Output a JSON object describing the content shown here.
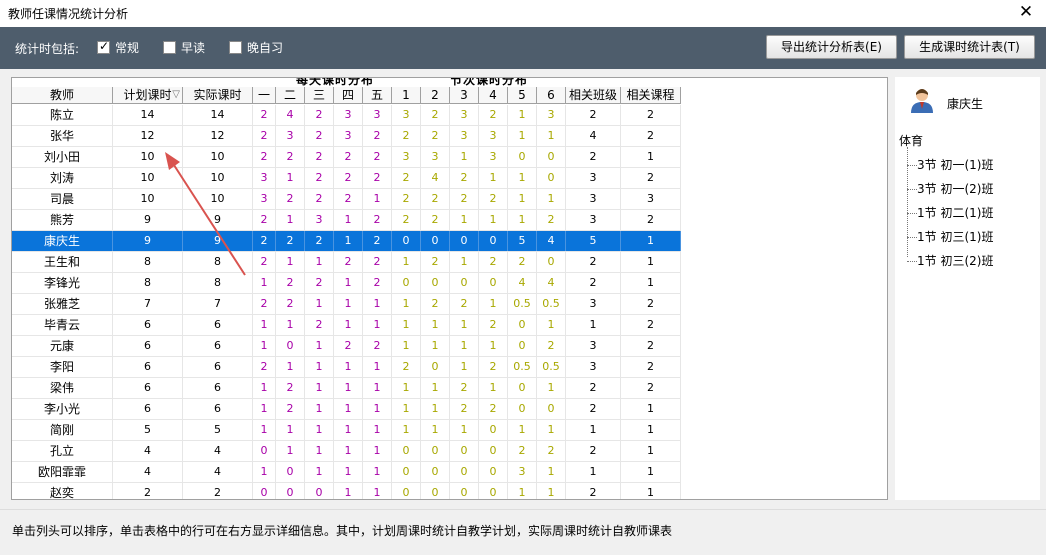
{
  "window": {
    "title": "教师任课情况统计分析",
    "close_glyph": "✕"
  },
  "options": {
    "label": "统计时包括:",
    "items": [
      {
        "label": "常规",
        "checked": true
      },
      {
        "label": "早读",
        "checked": false
      },
      {
        "label": "晚自习",
        "checked": false
      }
    ]
  },
  "buttons": {
    "export": "导出统计分析表(E)",
    "generate": "生成课时统计表(T)"
  },
  "table": {
    "group_daily": "每天课时分布",
    "group_period": "节次课时分布",
    "columns": [
      "教师",
      "计划课时",
      "实际课时",
      "一",
      "二",
      "三",
      "四",
      "五",
      "1",
      "2",
      "3",
      "4",
      "5",
      "6",
      "相关班级",
      "相关课程"
    ],
    "sort_glyph": "▽",
    "selected_row": 6,
    "rows": [
      [
        "陈立",
        "14",
        "14",
        "2",
        "4",
        "2",
        "3",
        "3",
        "3",
        "2",
        "3",
        "2",
        "1",
        "3",
        "2",
        "2"
      ],
      [
        "张华",
        "12",
        "12",
        "2",
        "3",
        "2",
        "3",
        "2",
        "2",
        "2",
        "3",
        "3",
        "1",
        "1",
        "4",
        "2"
      ],
      [
        "刘小田",
        "10",
        "10",
        "2",
        "2",
        "2",
        "2",
        "2",
        "3",
        "3",
        "1",
        "3",
        "0",
        "0",
        "2",
        "1"
      ],
      [
        "刘涛",
        "10",
        "10",
        "3",
        "1",
        "2",
        "2",
        "2",
        "2",
        "4",
        "2",
        "1",
        "1",
        "0",
        "3",
        "2"
      ],
      [
        "司晨",
        "10",
        "10",
        "3",
        "2",
        "2",
        "2",
        "1",
        "2",
        "2",
        "2",
        "2",
        "1",
        "1",
        "3",
        "3"
      ],
      [
        "熊芳",
        "9",
        "9",
        "2",
        "1",
        "3",
        "1",
        "2",
        "2",
        "2",
        "1",
        "1",
        "1",
        "2",
        "3",
        "2"
      ],
      [
        "康庆生",
        "9",
        "9",
        "2",
        "2",
        "2",
        "1",
        "2",
        "0",
        "0",
        "0",
        "0",
        "5",
        "4",
        "5",
        "1"
      ],
      [
        "王生和",
        "8",
        "8",
        "2",
        "1",
        "1",
        "2",
        "2",
        "1",
        "2",
        "1",
        "2",
        "2",
        "0",
        "2",
        "1"
      ],
      [
        "李锋光",
        "8",
        "8",
        "1",
        "2",
        "2",
        "1",
        "2",
        "0",
        "0",
        "0",
        "0",
        "4",
        "4",
        "2",
        "1"
      ],
      [
        "张雅芝",
        "7",
        "7",
        "2",
        "2",
        "1",
        "1",
        "1",
        "1",
        "2",
        "2",
        "1",
        "0.5",
        "0.5",
        "3",
        "2"
      ],
      [
        "毕青云",
        "6",
        "6",
        "1",
        "1",
        "2",
        "1",
        "1",
        "1",
        "1",
        "1",
        "2",
        "0",
        "1",
        "1",
        "2"
      ],
      [
        "元康",
        "6",
        "6",
        "1",
        "0",
        "1",
        "2",
        "2",
        "1",
        "1",
        "1",
        "1",
        "0",
        "2",
        "3",
        "2"
      ],
      [
        "李阳",
        "6",
        "6",
        "2",
        "1",
        "1",
        "1",
        "1",
        "2",
        "0",
        "1",
        "2",
        "0.5",
        "0.5",
        "3",
        "2"
      ],
      [
        "梁伟",
        "6",
        "6",
        "1",
        "2",
        "1",
        "1",
        "1",
        "1",
        "1",
        "2",
        "1",
        "0",
        "1",
        "2",
        "2"
      ],
      [
        "李小光",
        "6",
        "6",
        "1",
        "2",
        "1",
        "1",
        "1",
        "1",
        "1",
        "2",
        "2",
        "0",
        "0",
        "2",
        "1"
      ],
      [
        "简刚",
        "5",
        "5",
        "1",
        "1",
        "1",
        "1",
        "1",
        "1",
        "1",
        "1",
        "0",
        "1",
        "1",
        "1",
        "1"
      ],
      [
        "孔立",
        "4",
        "4",
        "0",
        "1",
        "1",
        "1",
        "1",
        "0",
        "0",
        "0",
        "0",
        "2",
        "2",
        "2",
        "1"
      ],
      [
        "欧阳霏霏",
        "4",
        "4",
        "1",
        "0",
        "1",
        "1",
        "1",
        "0",
        "0",
        "0",
        "0",
        "3",
        "1",
        "1",
        "1"
      ],
      [
        "赵奕",
        "2",
        "2",
        "0",
        "0",
        "0",
        "1",
        "1",
        "0",
        "0",
        "0",
        "0",
        "1",
        "1",
        "2",
        "1"
      ]
    ]
  },
  "detail": {
    "teacher_name": "康庆生",
    "subject": "体育",
    "classes": [
      "3节 初一(1)班",
      "3节 初一(2)班",
      "1节 初二(1)班",
      "1节 初三(1)班",
      "1节 初三(2)班"
    ]
  },
  "status_text": "单击列头可以排序，单击表格中的行可在右方显示详细信息。其中，计划周课时统计自教学计划，实际周课时统计自教师课表",
  "colors": {
    "toolbar": "#4e5d6c",
    "selected_row": "#0a74da",
    "daily_digits": "#a800a8",
    "period_digits": "#a8a800",
    "arrow": "#d9534f"
  }
}
